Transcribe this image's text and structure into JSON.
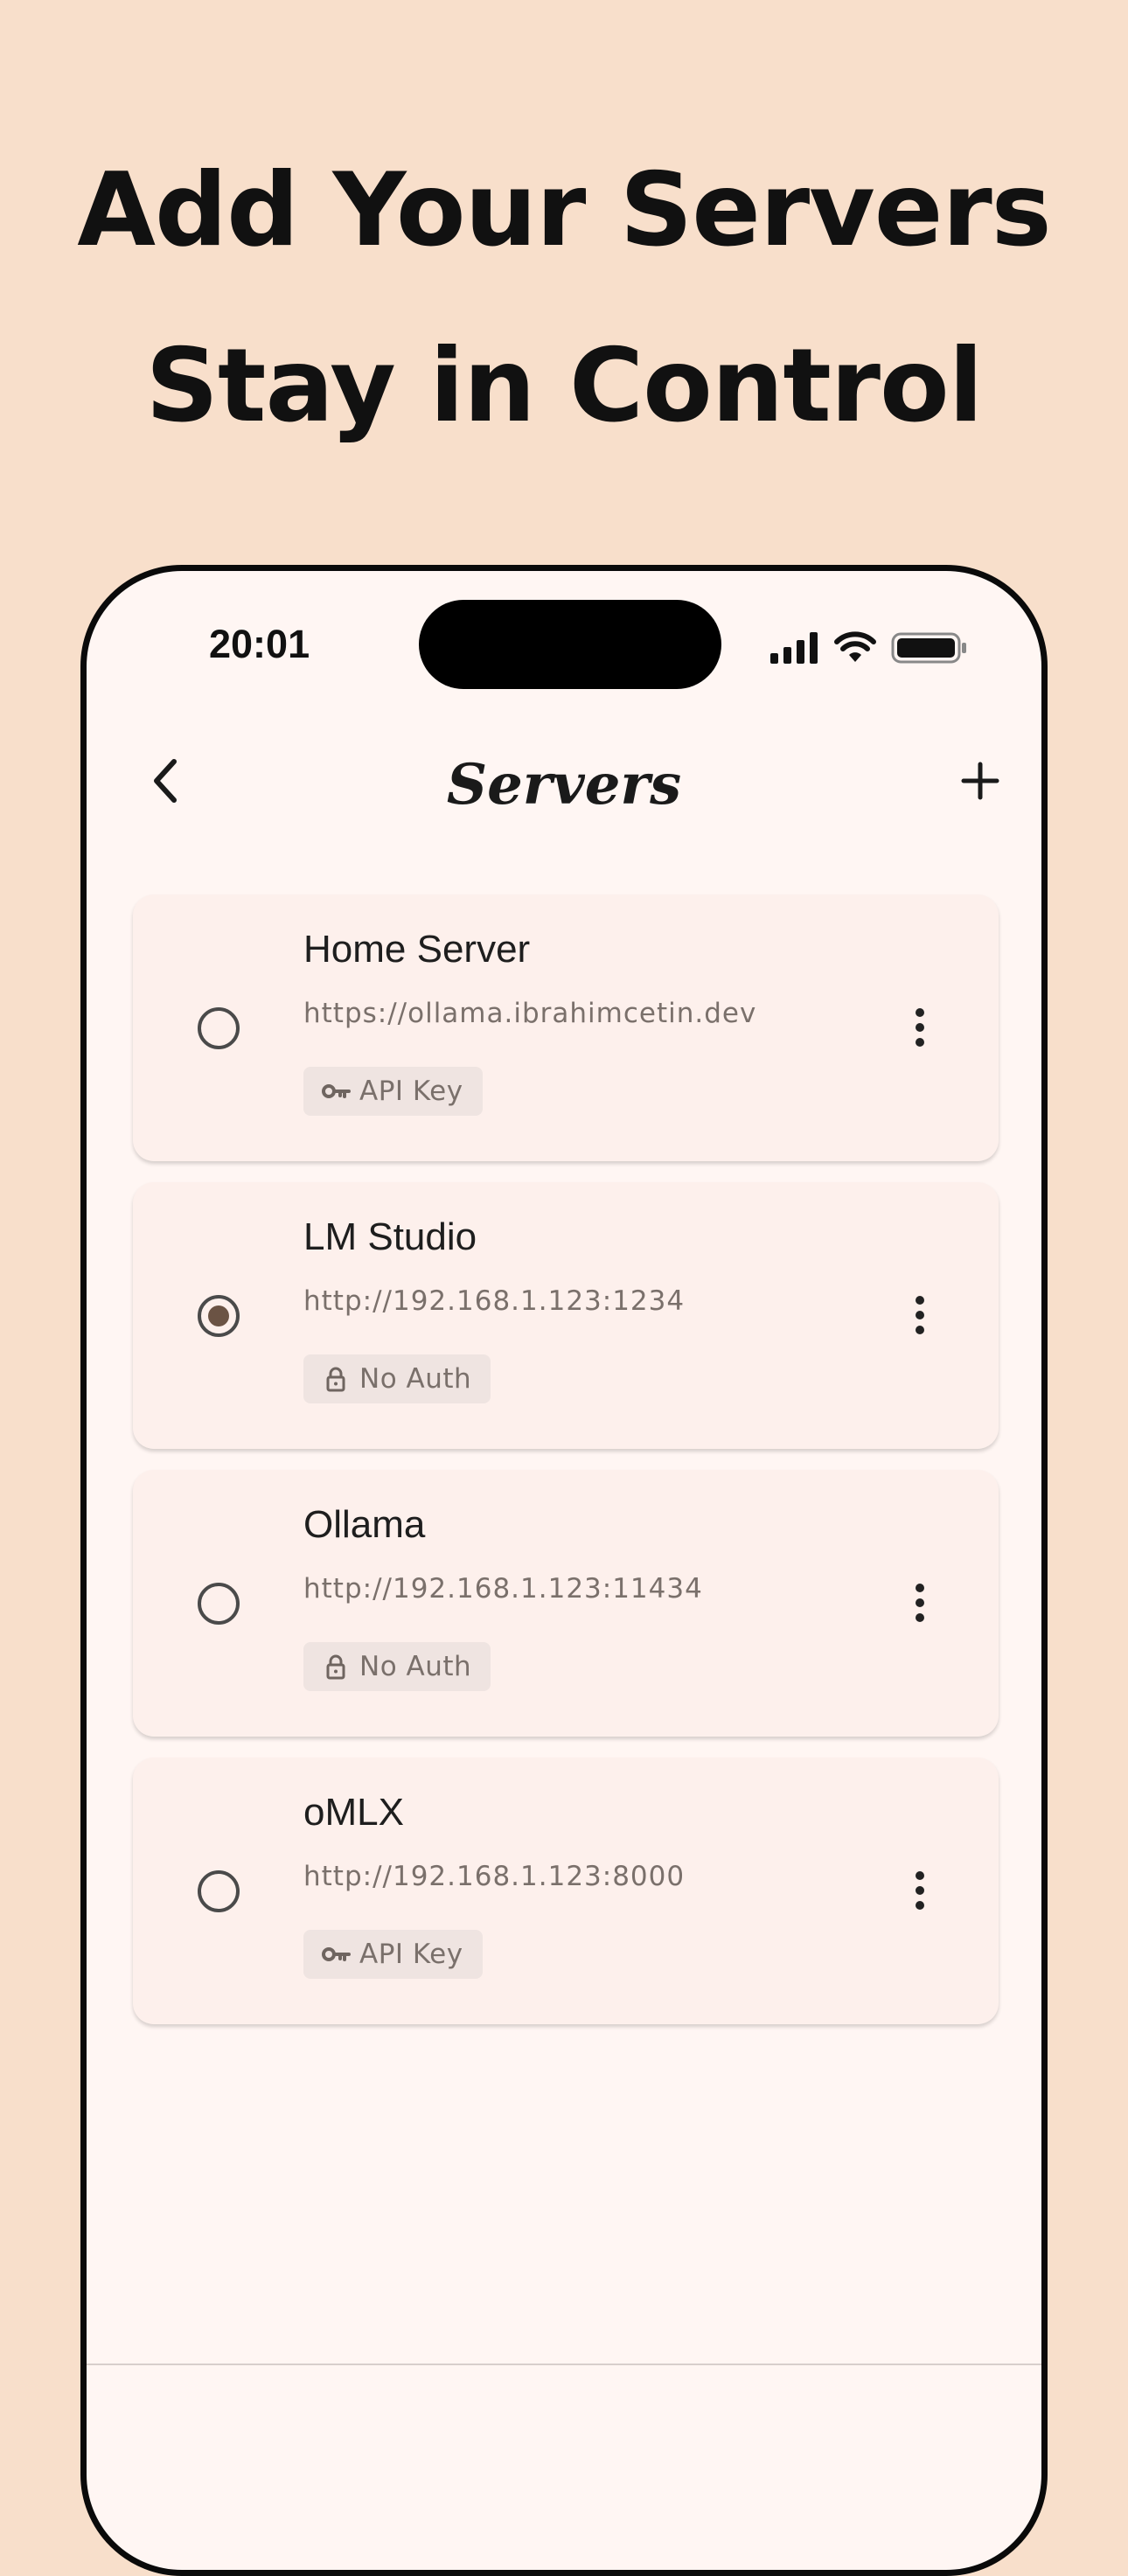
{
  "headline": {
    "line1": "Add Your Servers",
    "line2": "Stay in Control"
  },
  "status_bar": {
    "time": "20:01",
    "icons": [
      "signal-icon",
      "wifi-icon",
      "battery-icon"
    ]
  },
  "nav": {
    "title": "Servers",
    "back_icon": "chevron-left-icon",
    "add_icon": "plus-icon"
  },
  "servers": [
    {
      "name": "Home Server",
      "url": "https://ollama.ibrahimcetin.dev",
      "auth": "API Key",
      "auth_icon": "key-icon",
      "selected": false
    },
    {
      "name": "LM Studio",
      "url": "http://192.168.1.123:1234",
      "auth": "No Auth",
      "auth_icon": "lock-icon",
      "selected": true
    },
    {
      "name": "Ollama",
      "url": "http://192.168.1.123:11434",
      "auth": "No Auth",
      "auth_icon": "lock-icon",
      "selected": false
    },
    {
      "name": "oMLX",
      "url": "http://192.168.1.123:8000",
      "auth": "API Key",
      "auth_icon": "key-icon",
      "selected": false
    }
  ],
  "colors": {
    "background": "#f8dfcb",
    "phone_surface": "#fff6f3",
    "card": "#fdf0ec",
    "radio_selected": "#6b5344",
    "badge": "#efe4e1",
    "secondary_text": "#7a706b"
  }
}
